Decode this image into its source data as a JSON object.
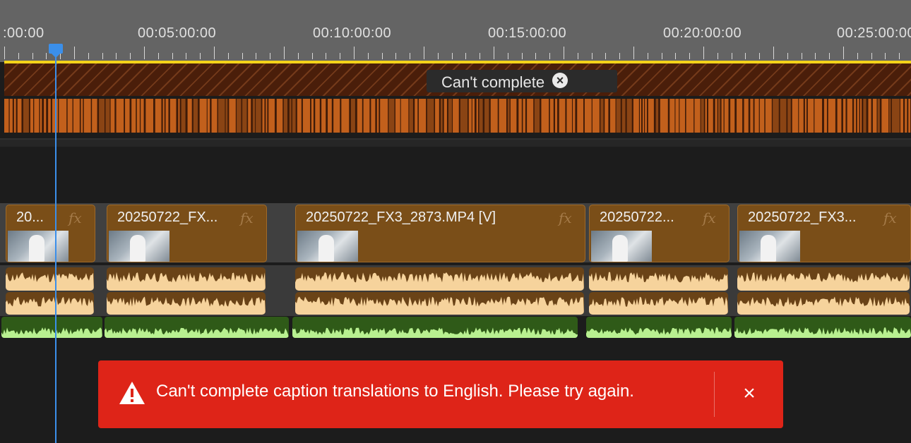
{
  "ruler": {
    "timecodes": [
      ":00:00",
      "00:05:00:00",
      "00:10:00:00",
      "00:15:00:00",
      "00:20:00:00",
      "00:25:00:00"
    ]
  },
  "captions_track": {
    "tooltip_text": "Can't complete",
    "tooltip_close_icon": "close-circle-icon"
  },
  "video_track": {
    "fx_label": "fx",
    "clips": [
      {
        "name": "20..."
      },
      {
        "name": "20250722_FX..."
      },
      {
        "name": "20250722_FX3_2873.MP4 [V]"
      },
      {
        "name": "20250722..."
      },
      {
        "name": "20250722_FX3..."
      }
    ]
  },
  "playhead": {
    "color": "#3b8fea"
  },
  "toast": {
    "icon": "warning-triangle-icon",
    "message": "Can't complete caption translations to English. Please try again.",
    "close_label": "×",
    "color": "#de2418"
  },
  "colors": {
    "video_clip": "#7a4e18",
    "audio_wave": "#f6d39c",
    "audio_green_wave": "#b8f090",
    "yellow_marker_line": "#f3d31a"
  }
}
